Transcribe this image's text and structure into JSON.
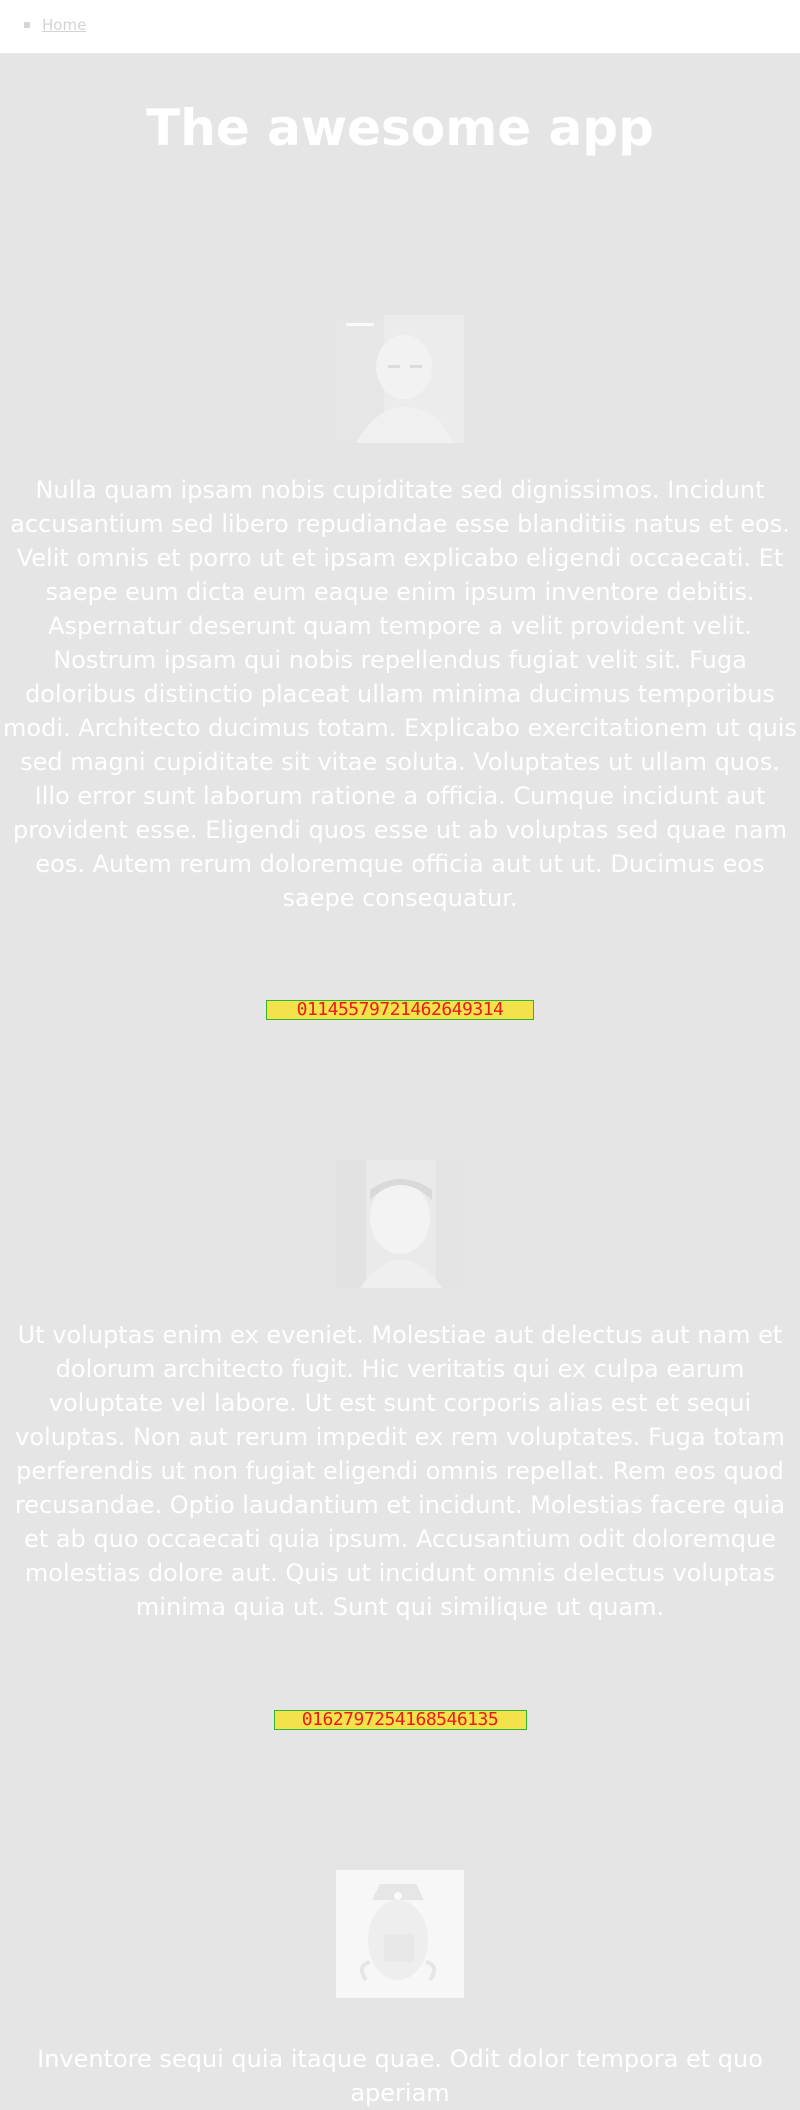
{
  "nav": {
    "items": [
      {
        "label": "Home"
      }
    ]
  },
  "app": {
    "title": "The awesome app"
  },
  "profiles": [
    {
      "name": "",
      "bio": "Nulla quam ipsam nobis cupiditate sed dignissimos. Incidunt accusantium sed libero repudiandae esse blanditiis natus et eos. Velit omnis et porro ut et ipsam explicabo eligendi occaecati. Et saepe eum dicta eum eaque enim ipsum inventore debitis. Aspernatur deserunt quam tempore a velit provident velit. Nostrum ipsam qui nobis repellendus fugiat velit sit. Fuga doloribus distinctio placeat ullam minima ducimus temporibus modi. Architecto ducimus totam. Explicabo exercitationem ut quis sed magni cupiditate sit vitae soluta. Voluptates ut ullam quos. Illo error sunt laborum ratione a officia. Cumque incidunt aut provident esse. Eligendi quos esse ut ab voluptas sed quae nam eos. Autem rerum doloremque officia aut ut ut. Ducimus eos saepe consequatur.",
      "phone_label": "",
      "phone": "01145579721462649314"
    },
    {
      "name": "",
      "bio": "Ut voluptas enim ex eveniet. Molestiae aut delectus aut nam et dolorum architecto fugit. Hic veritatis qui ex culpa earum voluptate vel labore. Ut est sunt corporis alias est et sequi voluptas. Non aut rerum impedit ex rem voluptates. Fuga totam perferendis ut non fugiat eligendi omnis repellat. Rem eos quod recusandae. Optio laudantium et incidunt. Molestias facere quia et ab quo occaecati quia ipsum. Accusantium odit doloremque molestias dolore aut. Quis ut incidunt omnis delectus voluptas minima quia ut. Sunt qui similique ut quam.",
      "phone_label": "",
      "phone": "0162797254168546135"
    },
    {
      "name": "",
      "bio": "Inventore sequi quia itaque quae. Odit dolor tempora et quo aperiam"
    }
  ]
}
